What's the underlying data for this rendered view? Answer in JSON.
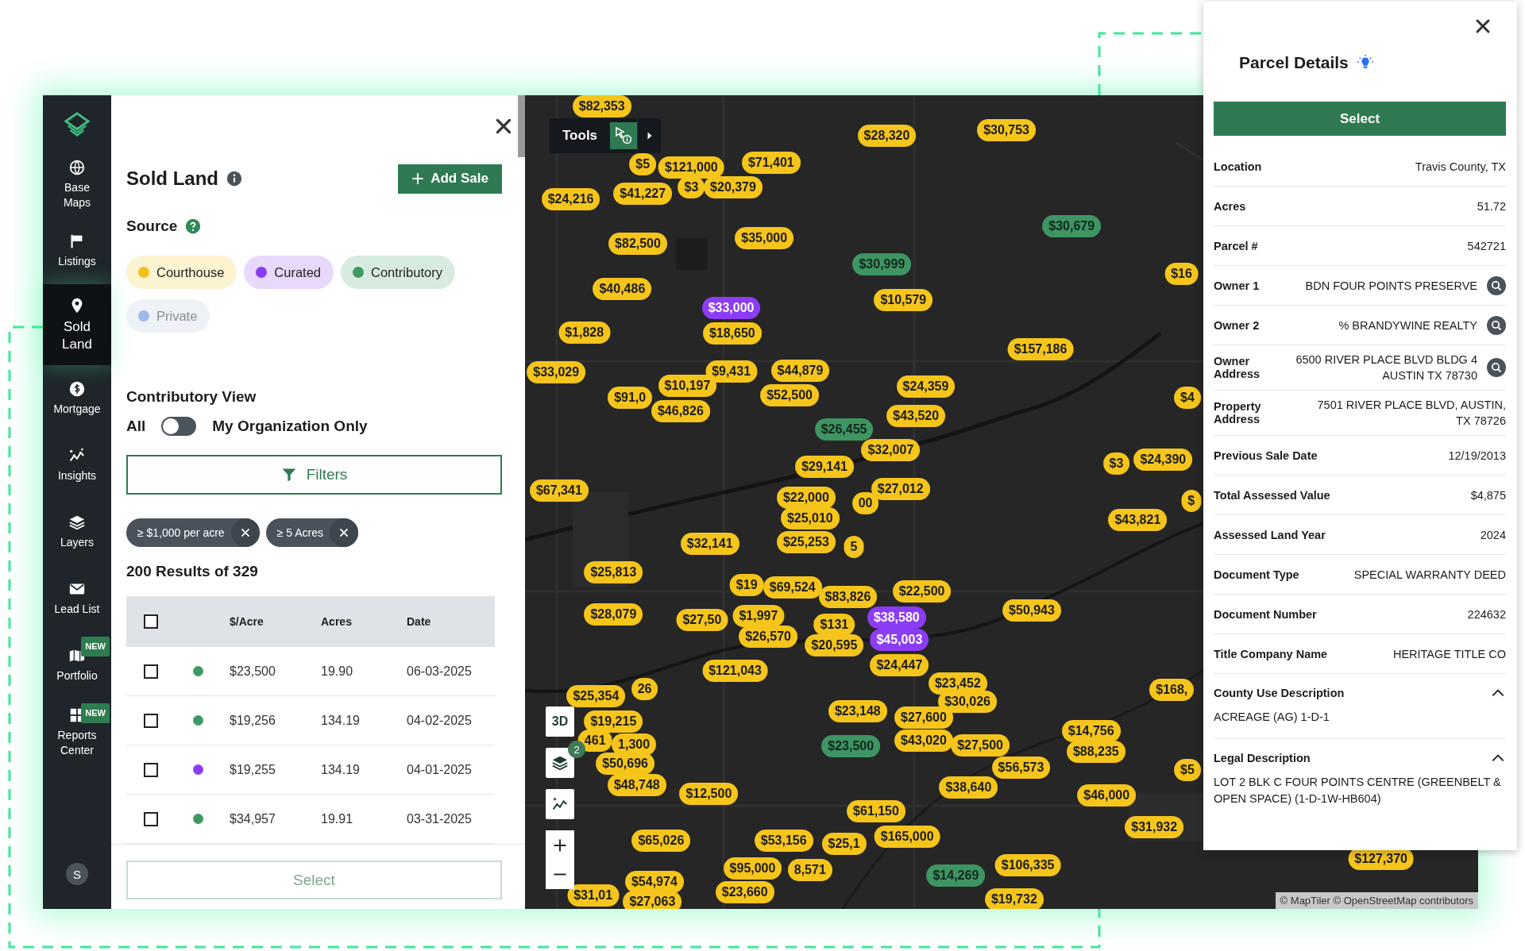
{
  "sidebar": {
    "items": [
      {
        "label": "Base Maps",
        "selected": false
      },
      {
        "label": "Listings",
        "selected": false
      },
      {
        "label": "Sold Land",
        "selected": true
      },
      {
        "label": "Mortgage",
        "selected": false
      },
      {
        "label": "Insights",
        "selected": false
      },
      {
        "label": "Layers",
        "selected": false
      },
      {
        "label": "Lead List",
        "selected": false
      },
      {
        "label": "Portfolio",
        "selected": false,
        "badge": "NEW"
      },
      {
        "label": "Reports Center",
        "selected": false,
        "badge": "NEW"
      }
    ],
    "avatar": "S"
  },
  "panel": {
    "title": "Sold Land",
    "add_button": "Add Sale",
    "source_label": "Source",
    "sources": [
      {
        "label": "Courthouse",
        "color": "#f2c21b",
        "selected": true
      },
      {
        "label": "Curated",
        "color": "#8b3cf0",
        "selected": true
      },
      {
        "label": "Contributory",
        "color": "#3e9a63",
        "selected": true
      },
      {
        "label": "Private",
        "color": "#a3b8ea",
        "selected": false
      }
    ],
    "view_label": "Contributory View",
    "toggle": {
      "left": "All",
      "right": "My Organization Only",
      "on": false
    },
    "filters_button": "Filters",
    "filter_tags": [
      "≥ $1,000 per acre",
      "≥ 5 Acres"
    ],
    "results": "200 Results of 329",
    "table": {
      "all_checked": false,
      "columns": [
        "$/Acre",
        "Acres",
        "Date"
      ],
      "rows": [
        {
          "checked": false,
          "color": "#3e9a63",
          "price": "$23,500",
          "acres": "19.90",
          "date": "06-03-2025"
        },
        {
          "checked": false,
          "color": "#3e9a63",
          "price": "$19,256",
          "acres": "134.19",
          "date": "04-02-2025"
        },
        {
          "checked": false,
          "color": "#8b3cf0",
          "price": "$19,255",
          "acres": "134.19",
          "date": "04-01-2025"
        },
        {
          "checked": false,
          "color": "#3e9a63",
          "price": "$34,957",
          "acres": "19.91",
          "date": "03-31-2025"
        }
      ]
    },
    "select_button": {
      "label": "Select",
      "disabled": true
    }
  },
  "map": {
    "tools_label": "Tools",
    "mode_button": "3D",
    "layers_count": "2",
    "attribution": "© MapTiler © OpenStreetMap contributors",
    "markers": [
      {
        "label": "$82,353",
        "color": "#f5c51b"
      },
      {
        "label": "$28,320",
        "color": "#f5c51b"
      },
      {
        "label": "$30,753",
        "color": "#f5c51b"
      },
      {
        "label": "$5",
        "color": "#f5c51b"
      },
      {
        "label": "$121,000",
        "color": "#f5c51b"
      },
      {
        "label": "$71,401",
        "color": "#f5c51b"
      },
      {
        "label": "$24,216",
        "color": "#f5c51b"
      },
      {
        "label": "$41,227",
        "color": "#f5c51b"
      },
      {
        "label": "$3",
        "color": "#f5c51b"
      },
      {
        "label": "$20,379",
        "color": "#f5c51b"
      },
      {
        "label": "$30,679",
        "color": "#3e9563"
      },
      {
        "label": "$82,500",
        "color": "#f5c51b"
      },
      {
        "label": "$35,000",
        "color": "#f5c51b"
      },
      {
        "label": "$30,999",
        "color": "#3e9563"
      },
      {
        "label": "$40,486",
        "color": "#f5c51b"
      },
      {
        "label": "$10,579",
        "color": "#f5c51b"
      },
      {
        "label": "$33,000",
        "color": "#8c3cf5"
      },
      {
        "label": "$1,828",
        "color": "#f5c51b"
      },
      {
        "label": "$18,650",
        "color": "#f5c51b"
      },
      {
        "label": "$157,186",
        "color": "#f5c51b"
      },
      {
        "label": "$33,029",
        "color": "#f5c51b"
      },
      {
        "label": "$9,431",
        "color": "#f5c51b"
      },
      {
        "label": "$44,879",
        "color": "#f5c51b"
      },
      {
        "label": "$91,0",
        "color": "#f5c51b"
      },
      {
        "label": "$10,197",
        "color": "#f5c51b"
      },
      {
        "label": "$46,826",
        "color": "#f5c51b"
      },
      {
        "label": "$52,500",
        "color": "#f5c51b"
      },
      {
        "label": "$24,359",
        "color": "#f5c51b"
      },
      {
        "label": "$43,520",
        "color": "#f5c51b"
      },
      {
        "label": "$32,007",
        "color": "#f5c51b"
      },
      {
        "label": "$26,455",
        "color": "#3e9563"
      },
      {
        "label": "$29,141",
        "color": "#f5c51b"
      },
      {
        "label": "$27,012",
        "color": "#f5c51b"
      },
      {
        "label": "$67,341",
        "color": "#f5c51b"
      },
      {
        "label": "$22,000",
        "color": "#f5c51b"
      },
      {
        "label": "00",
        "color": "#f5c51b"
      },
      {
        "label": "$25,010",
        "color": "#f5c51b"
      },
      {
        "label": "$43,821",
        "color": "#f5c51b"
      },
      {
        "label": "$32,141",
        "color": "#f5c51b"
      },
      {
        "label": "$25,253",
        "color": "#f5c51b"
      },
      {
        "label": "5",
        "color": "#f5c51b"
      },
      {
        "label": "$25,813",
        "color": "#f5c51b"
      },
      {
        "label": "$19",
        "color": "#f5c51b"
      },
      {
        "label": "$69,524",
        "color": "#f5c51b"
      },
      {
        "label": "$22,500",
        "color": "#f5c51b"
      },
      {
        "label": "$83,826",
        "color": "#f5c51b"
      },
      {
        "label": "$28,079",
        "color": "#f5c51b"
      },
      {
        "label": "$27,50",
        "color": "#f5c51b"
      },
      {
        "label": "$1,997",
        "color": "#f5c51b"
      },
      {
        "label": "$26,570",
        "color": "#f5c51b"
      },
      {
        "label": "$131",
        "color": "#f5c51b"
      },
      {
        "label": "$20,595",
        "color": "#f5c51b"
      },
      {
        "label": "$38,580",
        "color": "#8c3cf5"
      },
      {
        "label": "$45,003",
        "color": "#8c3cf5"
      },
      {
        "label": "$24,447",
        "color": "#f5c51b"
      },
      {
        "label": "$50,943",
        "color": "#f5c51b"
      },
      {
        "label": "$121,043",
        "color": "#f5c51b"
      },
      {
        "label": "$23,452",
        "color": "#f5c51b"
      },
      {
        "label": "26",
        "color": "#f5c51b"
      },
      {
        "label": "$25,354",
        "color": "#f5c51b"
      },
      {
        "label": "$30,026",
        "color": "#f5c51b"
      },
      {
        "label": "$19,215",
        "color": "#f5c51b"
      },
      {
        "label": "$27,600",
        "color": "#f5c51b"
      },
      {
        "label": "$23,148",
        "color": "#f5c51b"
      },
      {
        "label": "461",
        "color": "#f5c51b"
      },
      {
        "label": "1,300",
        "color": "#f5c51b"
      },
      {
        "label": "$43,020",
        "color": "#f5c51b"
      },
      {
        "label": "$23,500",
        "color": "#3e9563"
      },
      {
        "label": "$56,573",
        "color": "#f5c51b"
      },
      {
        "label": "$27,500",
        "color": "#f5c51b"
      },
      {
        "label": "$14,756",
        "color": "#f5c51b"
      },
      {
        "label": "$88,235",
        "color": "#f5c51b"
      },
      {
        "label": "$50,696",
        "color": "#f5c51b"
      },
      {
        "label": "$48,748",
        "color": "#f5c51b"
      },
      {
        "label": "$38,640",
        "color": "#f5c51b"
      },
      {
        "label": "$12,500",
        "color": "#f5c51b"
      },
      {
        "label": "$46,000",
        "color": "#f5c51b"
      },
      {
        "label": "$61,150",
        "color": "#f5c51b"
      },
      {
        "label": "$31,932",
        "color": "#f5c51b"
      },
      {
        "label": "$65,026",
        "color": "#f5c51b"
      },
      {
        "label": "$53,156",
        "color": "#f5c51b"
      },
      {
        "label": "$25,1",
        "color": "#f5c51b"
      },
      {
        "label": "$165,000",
        "color": "#f5c51b"
      },
      {
        "label": "$95,000",
        "color": "#f5c51b"
      },
      {
        "label": "8,571",
        "color": "#f5c51b"
      },
      {
        "label": "$106,335",
        "color": "#f5c51b"
      },
      {
        "label": "$14,269",
        "color": "#3e9563"
      },
      {
        "label": "$54,974",
        "color": "#f5c51b"
      },
      {
        "label": "$31,01",
        "color": "#f5c51b"
      },
      {
        "label": "$27,063",
        "color": "#f5c51b"
      },
      {
        "label": "$23,660",
        "color": "#f5c51b"
      },
      {
        "label": "$19,732",
        "color": "#f5c51b"
      },
      {
        "label": "$127,370",
        "color": "#f5c51b"
      },
      {
        "label": "$16",
        "color": "#f5c51b"
      },
      {
        "label": "$4",
        "color": "#f5c51b"
      },
      {
        "label": "$3",
        "color": "#f5c51b"
      },
      {
        "label": "$24,390",
        "color": "#f5c51b"
      },
      {
        "label": "$",
        "color": "#f5c51b"
      },
      {
        "label": "$168,",
        "color": "#f5c51b"
      },
      {
        "label": "$5",
        "color": "#f5c51b"
      }
    ]
  },
  "parcel": {
    "title": "Parcel Details",
    "select_button": "Select",
    "fields": [
      {
        "label": "Location",
        "value": "Travis County, TX",
        "search": false
      },
      {
        "label": "Acres",
        "value": "51.72",
        "search": false
      },
      {
        "label": "Parcel #",
        "value": "542721",
        "search": false
      },
      {
        "label": "Owner 1",
        "value": "BDN FOUR POINTS PRESERVE",
        "search": true
      },
      {
        "label": "Owner 2",
        "value": "% BRANDYWINE REALTY",
        "search": true
      },
      {
        "label": "Owner Address",
        "value": "6500 RIVER PLACE BLVD BLDG 4 AUSTIN TX 78730",
        "search": true
      },
      {
        "label": "Property Address",
        "value": "7501 RIVER PLACE BLVD, AUSTIN, TX 78726",
        "search": false
      },
      {
        "label": "Previous Sale Date",
        "value": "12/19/2013",
        "search": false
      },
      {
        "label": "Total Assessed Value",
        "value": "$4,875",
        "search": false
      },
      {
        "label": "Assessed Land Year",
        "value": "2024",
        "search": false
      },
      {
        "label": "Document Type",
        "value": "SPECIAL WARRANTY DEED",
        "search": false
      },
      {
        "label": "Document Number",
        "value": "224632",
        "search": false
      },
      {
        "label": "Title Company Name",
        "value": "HERITAGE TITLE CO",
        "search": false
      }
    ],
    "sections": [
      {
        "title": "County Use Description",
        "expanded": true,
        "text": "ACREAGE (AG) 1-D-1"
      },
      {
        "title": "Legal Description",
        "expanded": true,
        "text": "LOT 2 BLK C FOUR POINTS CENTRE (GREENBELT & OPEN SPACE) (1-D-1W-HB604)"
      }
    ]
  }
}
